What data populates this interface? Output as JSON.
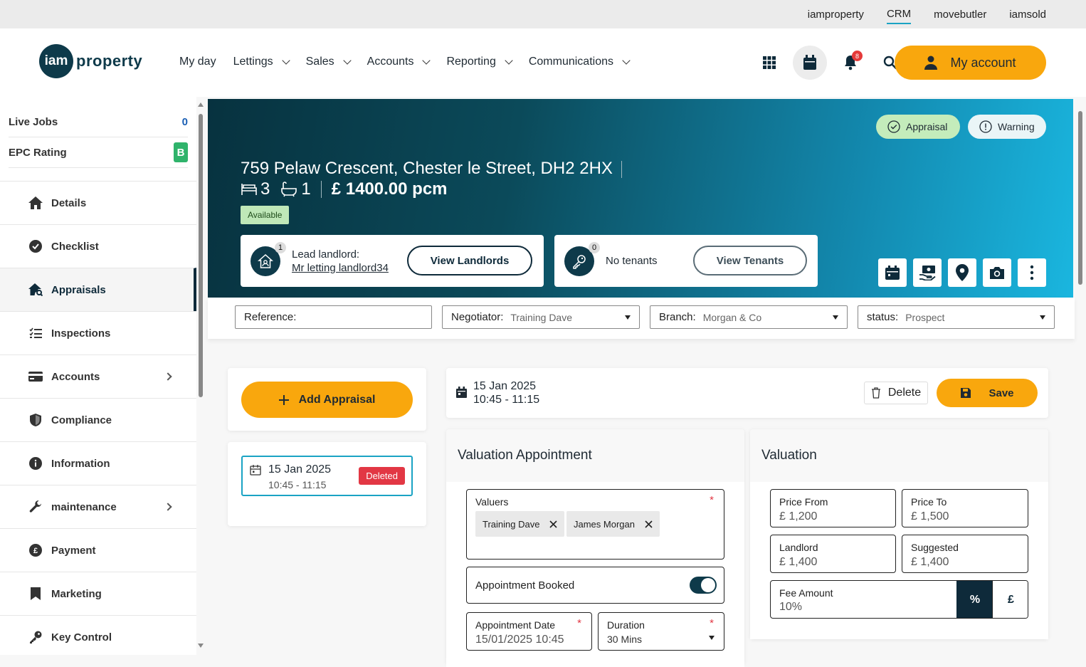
{
  "topbar": {
    "links": [
      "iamproperty",
      "CRM",
      "movebutler",
      "iamsold"
    ]
  },
  "header": {
    "logo": {
      "iam": "iam",
      "property": "property"
    },
    "nav": [
      "My day",
      "Lettings",
      "Sales",
      "Accounts",
      "Reporting",
      "Communications"
    ],
    "notification_count": "8",
    "account_label": "My account"
  },
  "sidebar": {
    "live_jobs_label": "Live Jobs",
    "live_jobs_count": "0",
    "epc_label": "EPC Rating",
    "epc_value": "B",
    "items": [
      "Details",
      "Checklist",
      "Appraisals",
      "Inspections",
      "Accounts",
      "Compliance",
      "Information",
      "maintenance",
      "Payment",
      "Marketing",
      "Key Control"
    ]
  },
  "hero": {
    "address": "759 Pelaw Crescent, Chester le Street, DH2 2HX",
    "beds": "3",
    "baths": "1",
    "price": "£ 1400.00 pcm",
    "status_tag": "Available",
    "pill_appraisal": "Appraisal",
    "pill_warning": "Warning",
    "landlord_count": "1",
    "lead_landlord_label": "Lead landlord:",
    "lead_landlord_name": "Mr letting landlord34",
    "view_landlords": "View Landlords",
    "tenant_count": "0",
    "tenants_label": "No tenants",
    "view_tenants": "View Tenants"
  },
  "filters": {
    "reference_label": "Reference:",
    "negotiator_label": "Negotiator:",
    "negotiator_value": "Training Dave",
    "branch_label": "Branch:",
    "branch_value": "Morgan & Co",
    "status_label": "status:",
    "status_value": "Prospect"
  },
  "appraisals": {
    "add_label": "Add Appraisal",
    "list": [
      {
        "date": "15 Jan 2025",
        "time": "10:45 - 11:15",
        "badge": "Deleted"
      }
    ]
  },
  "appointment_bar": {
    "date": "15 Jan 2025",
    "time": "10:45 - 11:15",
    "delete_label": "Delete",
    "save_label": "Save"
  },
  "valuation_appointment": {
    "title": "Valuation Appointment",
    "valuers_label": "Valuers",
    "valuers": [
      "Training Dave",
      "James Morgan"
    ],
    "booked_label": "Appointment Booked",
    "date_label": "Appointment Date",
    "date_value": "15/01/2025 10:45",
    "duration_label": "Duration",
    "duration_value": "30 Mins"
  },
  "valuation": {
    "title": "Valuation",
    "price_from_label": "Price From",
    "price_from": "£ 1,200",
    "price_to_label": "Price To",
    "price_to": "£ 1,500",
    "landlord_label": "Landlord",
    "landlord": "£ 1,400",
    "suggested_label": "Suggested",
    "suggested": "£ 1,400",
    "fee_label": "Fee Amount",
    "fee_value": "10%",
    "pct_symbol": "%",
    "gbp_symbol": "£"
  },
  "colors": {
    "accent": "#f9a70d",
    "navy": "#0e3a4a",
    "teal": "#1aa3c4",
    "danger": "#e23744"
  }
}
